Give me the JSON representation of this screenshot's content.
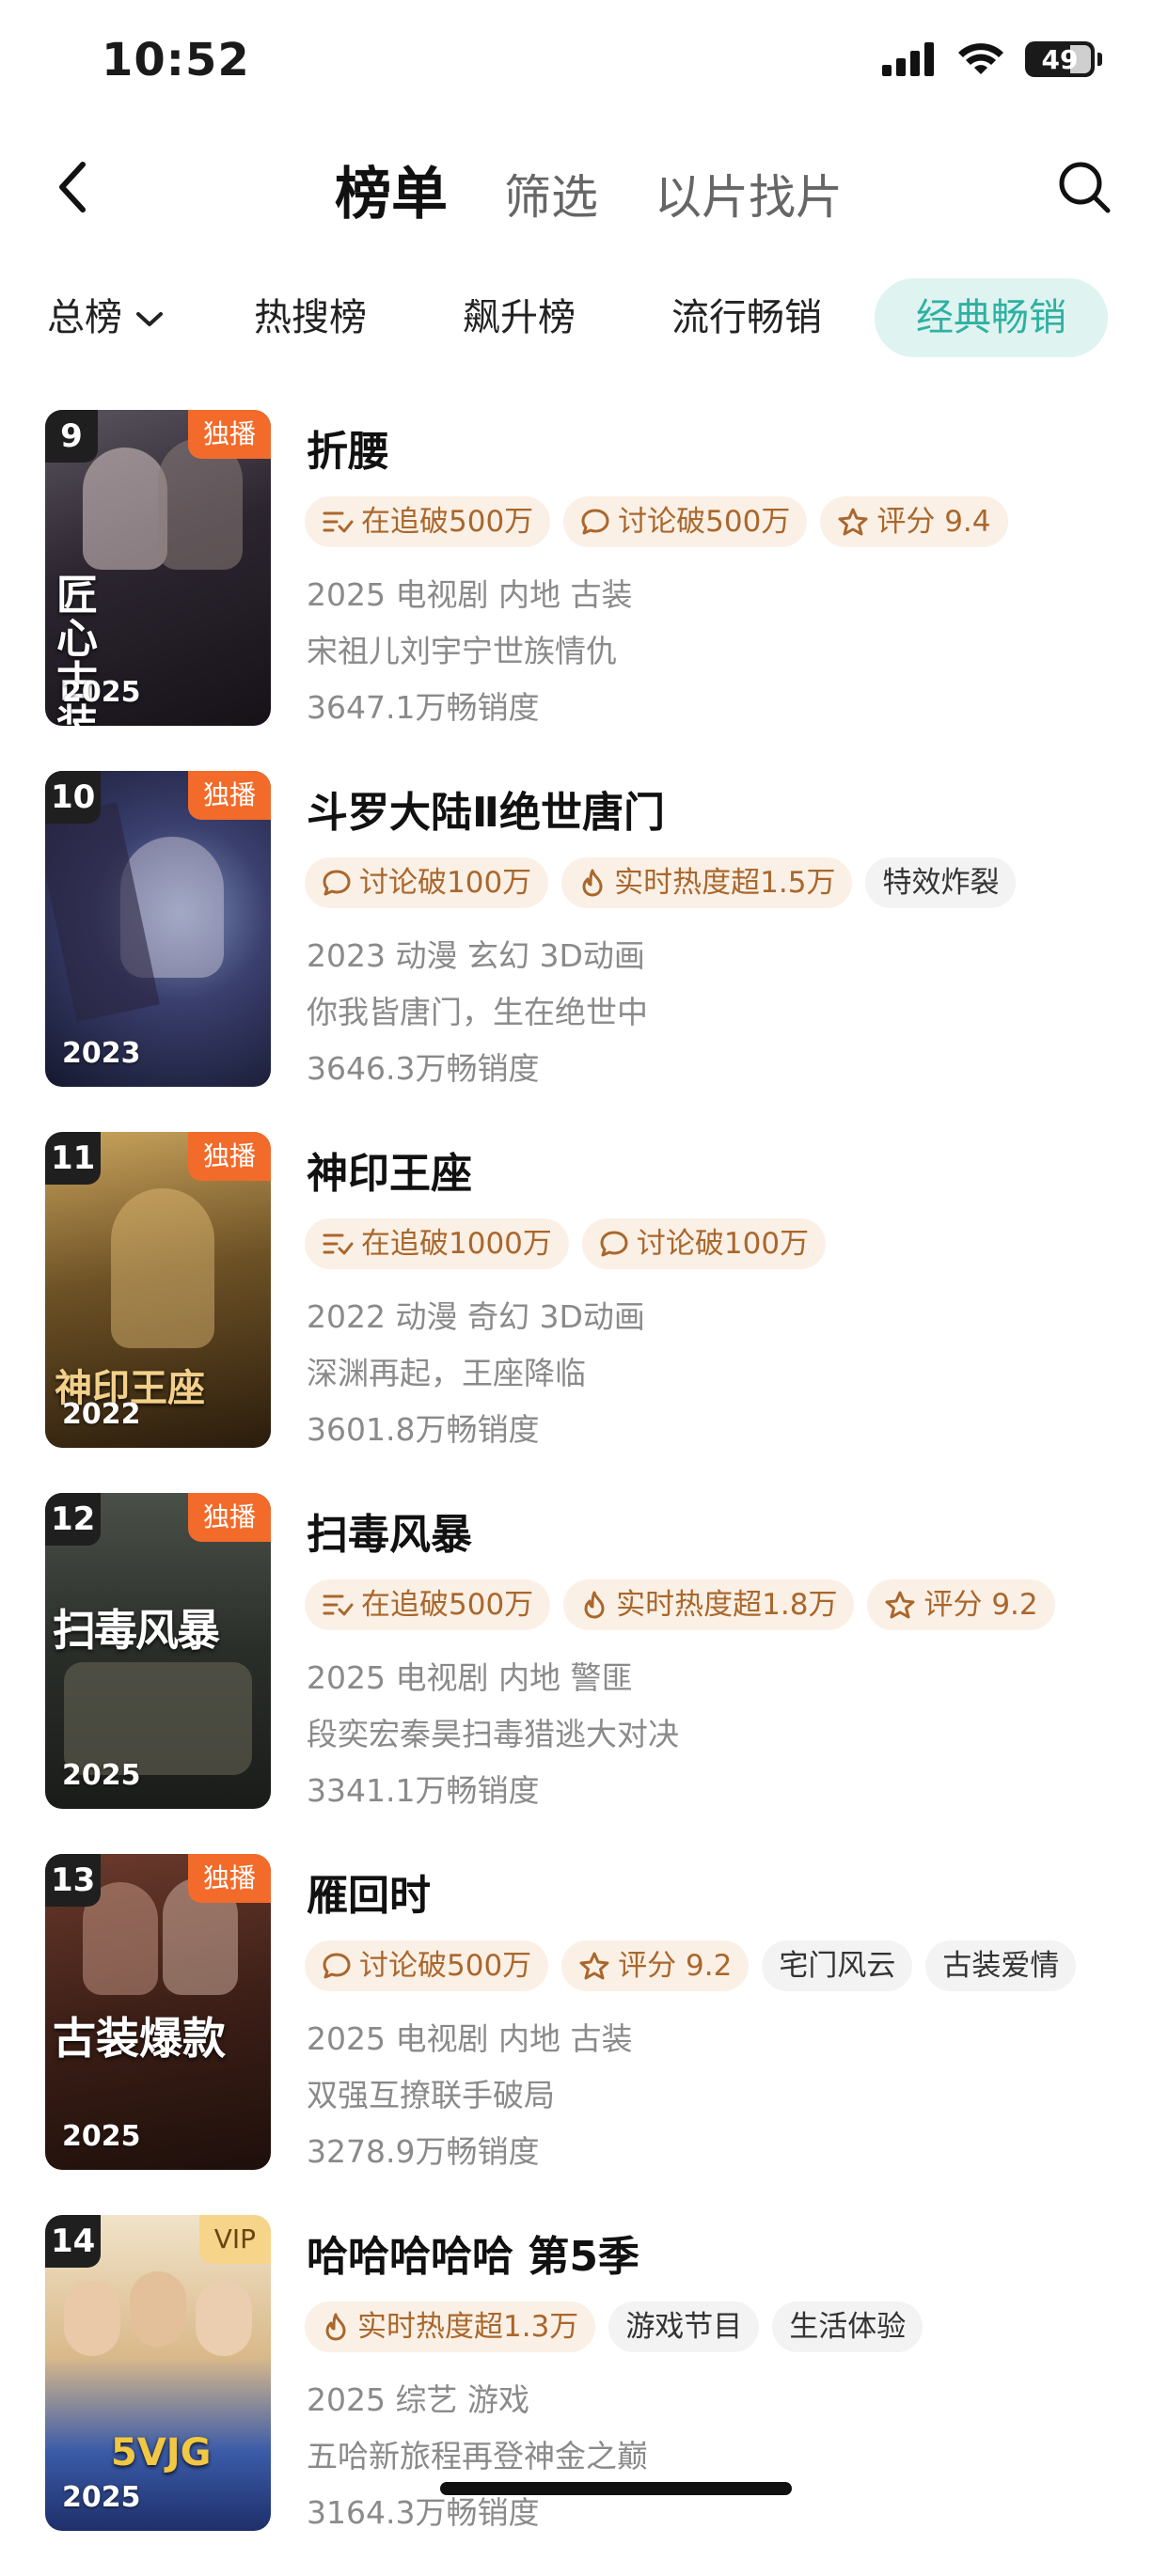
{
  "status_bar": {
    "time": "10:52",
    "battery": "49"
  },
  "nav": {
    "tabs": [
      {
        "label": "榜单",
        "active": true
      },
      {
        "label": "筛选",
        "active": false
      },
      {
        "label": "以片找片",
        "active": false
      }
    ]
  },
  "categories": [
    {
      "label": "总榜",
      "active": false
    },
    {
      "label": "热搜榜",
      "active": false
    },
    {
      "label": "飙升榜",
      "active": false
    },
    {
      "label": "流行畅销",
      "active": false
    },
    {
      "label": "经典畅销",
      "active": true
    }
  ],
  "colors": {
    "accent": "#2fb1a2",
    "accent_bg": "#dff3f0",
    "badge_exclusive": "#f26b2a",
    "badge_vip": "#f6d48a",
    "tag_hot_bg": "#fbf0e5",
    "tag_hot_text": "#a9672d"
  },
  "items": [
    {
      "rank": "9",
      "badge": "独播",
      "poster_year": "2025",
      "poster_text": "匠心 古装",
      "title": "折腰",
      "tags": [
        {
          "icon": "follow-icon",
          "text": "在追破500万"
        },
        {
          "icon": "comment-icon",
          "text": "讨论破500万"
        },
        {
          "icon": "star-icon",
          "text": "评分 9.4"
        }
      ],
      "meta": "2025 电视剧 内地 古装",
      "desc": "宋祖儿刘宇宁世族情仇",
      "sales": "3647.1万畅销度"
    },
    {
      "rank": "10",
      "badge": "独播",
      "poster_year": "2023",
      "poster_text": "",
      "title": "斗罗大陆Ⅱ绝世唐门",
      "tags": [
        {
          "icon": "comment-icon",
          "text": "讨论破100万"
        },
        {
          "icon": "flame-icon",
          "text": "实时热度超1.5万"
        },
        {
          "icon": "",
          "text": "特效炸裂"
        }
      ],
      "meta": "2023 动漫 玄幻 3D动画",
      "desc": "你我皆唐门，生在绝世中",
      "sales": "3646.3万畅销度"
    },
    {
      "rank": "11",
      "badge": "独播",
      "poster_year": "2022",
      "poster_text": "神印王座",
      "title": "神印王座",
      "tags": [
        {
          "icon": "follow-icon",
          "text": "在追破1000万"
        },
        {
          "icon": "comment-icon",
          "text": "讨论破100万"
        }
      ],
      "meta": "2022 动漫 奇幻 3D动画",
      "desc": "深渊再起，王座降临",
      "sales": "3601.8万畅销度"
    },
    {
      "rank": "12",
      "badge": "独播",
      "poster_year": "2025",
      "poster_text": "扫毒风暴",
      "title": "扫毒风暴",
      "tags": [
        {
          "icon": "follow-icon",
          "text": "在追破500万"
        },
        {
          "icon": "flame-icon",
          "text": "实时热度超1.8万"
        },
        {
          "icon": "star-icon",
          "text": "评分 9.2"
        }
      ],
      "meta": "2025 电视剧 内地 警匪",
      "desc": "段奕宏秦昊扫毒猎逃大对决",
      "sales": "3341.1万畅销度"
    },
    {
      "rank": "13",
      "badge": "独播",
      "poster_year": "2025",
      "poster_text": "古装爆款",
      "title": "雁回时",
      "tags": [
        {
          "icon": "comment-icon",
          "text": "讨论破500万"
        },
        {
          "icon": "star-icon",
          "text": "评分 9.2"
        },
        {
          "icon": "",
          "text": "宅门风云"
        },
        {
          "icon": "",
          "text": "古装爱情"
        }
      ],
      "meta": "2025 电视剧 内地 古装",
      "desc": "双强互撩联手破局",
      "sales": "3278.9万畅销度"
    },
    {
      "rank": "14",
      "badge": "VIP",
      "poster_year": "2025",
      "poster_text": "5VJG",
      "title": "哈哈哈哈哈 第5季",
      "tags": [
        {
          "icon": "flame-icon",
          "text": "实时热度超1.3万"
        },
        {
          "icon": "",
          "text": "游戏节目"
        },
        {
          "icon": "",
          "text": "生活体验"
        }
      ],
      "meta": "2025 综艺 游戏",
      "desc": "五哈新旅程再登神金之巅",
      "sales": "3164.3万畅销度"
    }
  ]
}
